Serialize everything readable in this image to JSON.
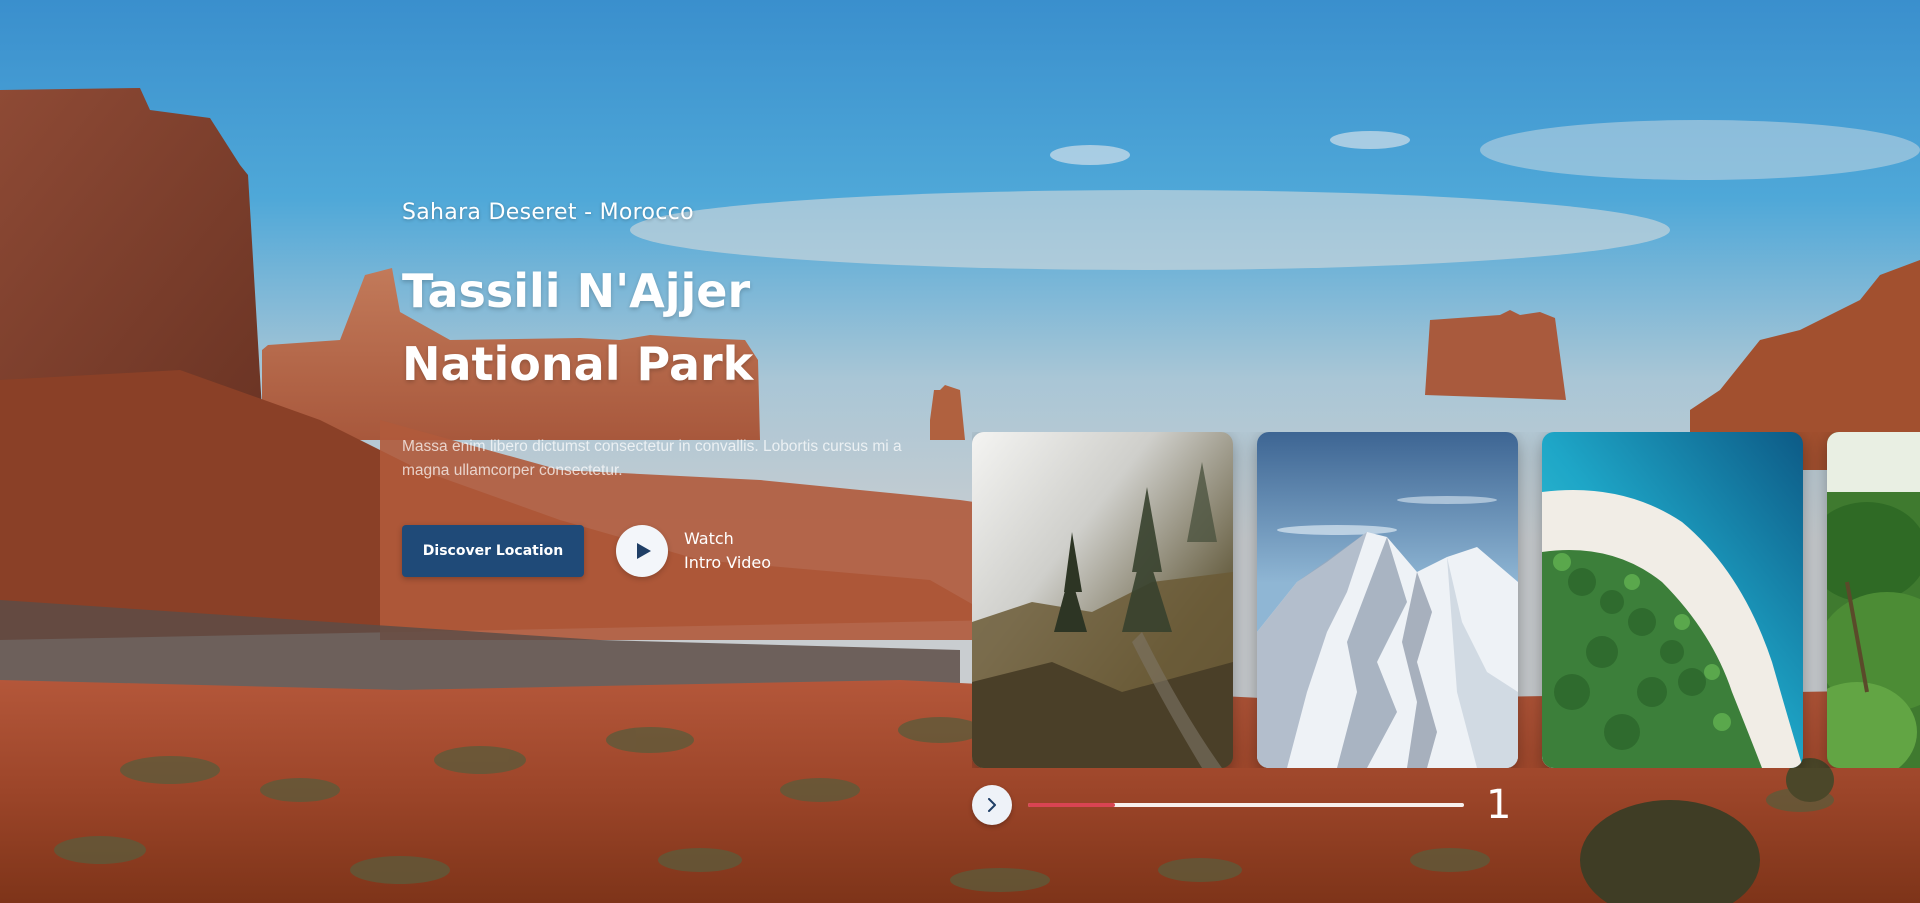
{
  "hero": {
    "subtitle": "Sahara Deseret - Morocco",
    "title_line1": "Tassili N'Ajjer",
    "title_line2": "National Park",
    "description": "Massa enim libero dictumst consectetur in convallis. Lobortis cursus mi a magna ullamcorper consectetur.",
    "discover_label": "Discover Location",
    "watch_line1": "Watch",
    "watch_line2": "Intro Video"
  },
  "cards": [
    {
      "scene": "foggy-forest"
    },
    {
      "scene": "snowy-mountain"
    },
    {
      "scene": "tropical-beach"
    },
    {
      "scene": "green-jungle"
    }
  ],
  "slider": {
    "current": "1",
    "progress": 0.2
  },
  "colors": {
    "accent_button": "#1f4a78",
    "progress_fill": "#d94452",
    "sky_top": "#3a86c2"
  },
  "icons": {
    "play": "play-icon",
    "next": "chevron-right-icon"
  }
}
